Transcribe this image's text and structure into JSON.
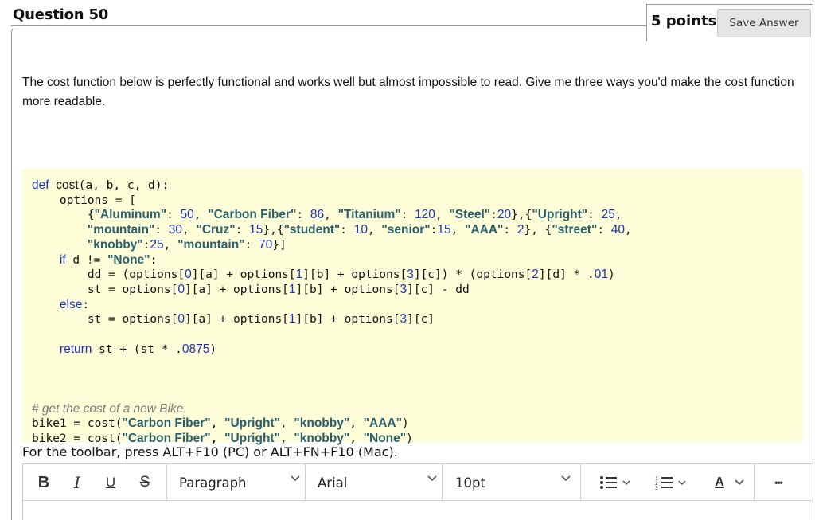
{
  "question": {
    "title": "Question 50",
    "points": "5 points",
    "save_label": "Save Answer",
    "prompt": "The cost function below is perfectly functional and works well but almost impossible to read.  Give me three ways you'd make the cost function more readable."
  },
  "code": {
    "lines": [
      "def cost(a, b, c, d):",
      "    options = [",
      "        {\"Aluminum\": 50, \"Carbon Fiber\": 86, \"Titanium\": 120, \"Steel\":20},{\"Upright\": 25,",
      "        \"mountain\": 30, \"Cruz\": 15},{\"student\": 10, \"senior\":15, \"AAA\": 2}, {\"street\": 40,",
      "        \"knobby\":25, \"mountain\": 70}]",
      "    if d != \"None\":",
      "        dd = (options[0][a] + options[1][b] + options[3][c]) * (options[2][d] * .01)",
      "        st = options[0][a] + options[1][b] + options[3][c] - dd",
      "    else:",
      "        st = options[0][a] + options[1][b] + options[3][c]",
      "",
      "    return st + (st * .0875)",
      "",
      "",
      "",
      "# get the cost of a new Bike",
      "bike1 = cost(\"Carbon Fiber\", \"Upright\", \"knobby\", \"AAA\")",
      "bike2 = cost(\"Carbon Fiber\", \"Upright\", \"knobby\", \"None\")"
    ]
  },
  "editor": {
    "toolbar_hint": "For the toolbar, press ALT+F10 (PC) or ALT+FN+F10 (Mac).",
    "bold_label": "B",
    "italic_label": "I",
    "underline_label": "U",
    "strike_label": "S",
    "paragraph_select": "Paragraph",
    "font_select": "Arial",
    "size_select": "10pt",
    "text_color_label": "A",
    "more_label": "•••",
    "icons": [
      "bold-icon",
      "italic-icon",
      "underline-icon",
      "strikethrough-icon",
      "bullet-list-icon",
      "numbered-list-icon",
      "text-color-icon",
      "more-icon",
      "chevron-down-icon"
    ]
  }
}
